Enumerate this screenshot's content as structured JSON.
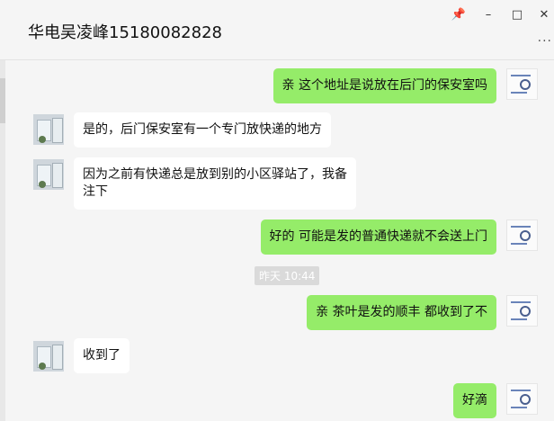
{
  "window": {
    "title": "华电吴凌峰15180082828",
    "pin_icon": "📌",
    "minimize_icon": "–",
    "maximize_icon": "□",
    "close_icon": "✕",
    "more_icon": "···"
  },
  "chat": {
    "timestamp": "昨天 10:44",
    "messages": [
      {
        "side": "me",
        "text": "亲 这个地址是说放在后门的保安室吗"
      },
      {
        "side": "them",
        "text": "是的，后门保安室有一个专门放快递的地方"
      },
      {
        "side": "them",
        "text": "因为之前有快递总是放到别的小区驿站了，我备注下"
      },
      {
        "side": "me",
        "text": "好的 可能是发的普通快递就不会送上门"
      },
      {
        "side": "me",
        "text": "亲 茶叶是发的顺丰 都收到了不"
      },
      {
        "side": "them",
        "text": "收到了"
      },
      {
        "side": "me",
        "text": "好滴"
      }
    ]
  }
}
